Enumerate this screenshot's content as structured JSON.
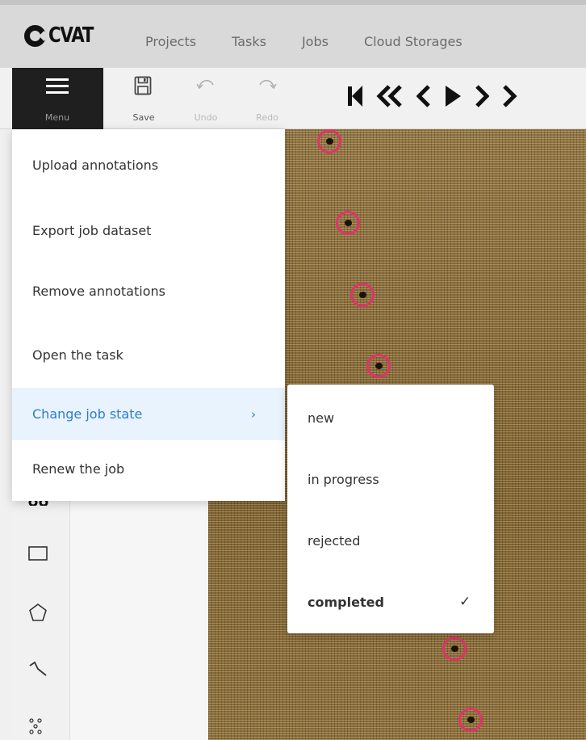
{
  "app": {
    "logo_text": "CVAT"
  },
  "nav": {
    "links": [
      "Projects",
      "Tasks",
      "Jobs",
      "Cloud Storages"
    ]
  },
  "toolbar": {
    "menu_label": "Menu",
    "save_label": "Save",
    "undo_label": "Undo",
    "redo_label": "Redo"
  },
  "menu": {
    "items": [
      "Upload annotations",
      "Export job dataset",
      "Remove annotations",
      "Open the task",
      "Change job state",
      "Renew the job"
    ],
    "arrow": "›"
  },
  "job_state_submenu": {
    "options": [
      "new",
      "in progress",
      "rejected",
      "completed"
    ],
    "selected": "completed",
    "check": "✓"
  },
  "colors": {
    "accent": "#2d7bd1",
    "point_outline": "#e0336a",
    "menu_active_bg": "#e9f3fd"
  }
}
